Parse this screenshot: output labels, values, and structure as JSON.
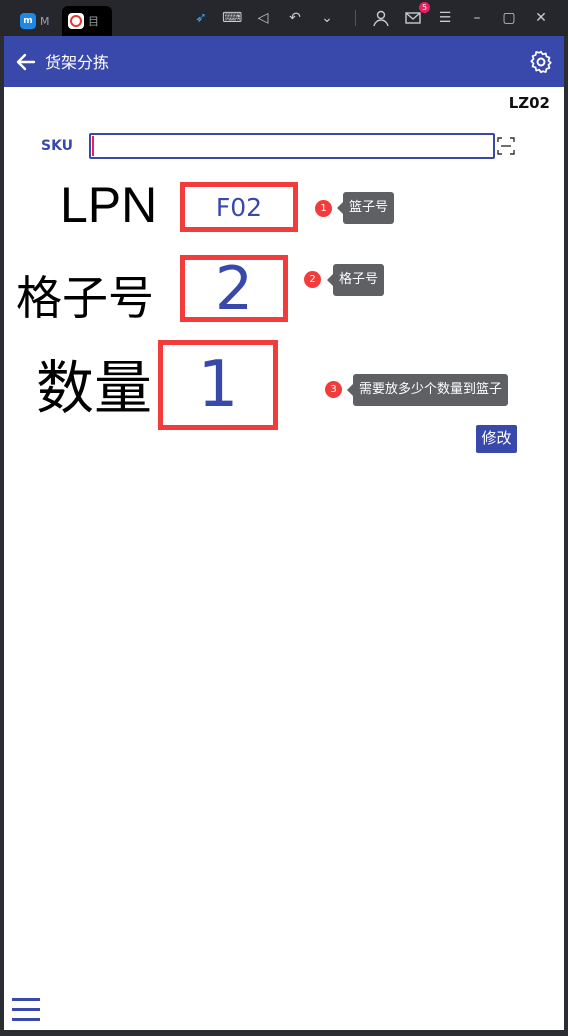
{
  "emulator": {
    "tabs": [
      {
        "label": "M"
      },
      {
        "label": "目"
      }
    ],
    "mail_badge": "5"
  },
  "app": {
    "title": "货架分拣",
    "station": "LZ02",
    "accent": "#3949ab"
  },
  "sku": {
    "label": "SKU",
    "value": "",
    "placeholder": ""
  },
  "lpn": {
    "label": "LPN",
    "value": "F02"
  },
  "grid": {
    "label": "格子号",
    "value": "2"
  },
  "qty": {
    "label": "数量",
    "value": "1"
  },
  "annotations": [
    {
      "num": "1",
      "text": "篮子号"
    },
    {
      "num": "2",
      "text": "格子号"
    },
    {
      "num": "3",
      "text": "需要放多少个数量到篮子"
    }
  ],
  "edit_label": "修改"
}
